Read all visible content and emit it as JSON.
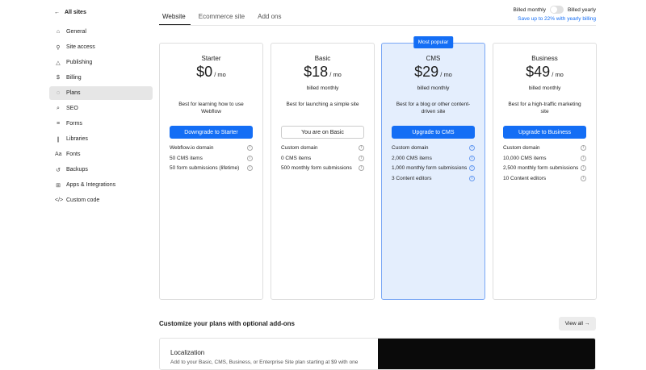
{
  "sidebar": {
    "back": "All sites",
    "items": [
      {
        "label": "General",
        "icon": "⌂"
      },
      {
        "label": "Site access",
        "icon": "⚲"
      },
      {
        "label": "Publishing",
        "icon": "△"
      },
      {
        "label": "Billing",
        "icon": "$"
      },
      {
        "label": "Plans",
        "icon": "◌"
      },
      {
        "label": "SEO",
        "icon": "⌕"
      },
      {
        "label": "Forms",
        "icon": "≡"
      },
      {
        "label": "Libraries",
        "icon": "∥"
      },
      {
        "label": "Fonts",
        "icon": "Aa"
      },
      {
        "label": "Backups",
        "icon": "↺"
      },
      {
        "label": "Apps & Integrations",
        "icon": "⊞"
      },
      {
        "label": "Custom code",
        "icon": "</>"
      }
    ]
  },
  "tabs": [
    "Website",
    "Ecommerce site",
    "Add ons"
  ],
  "billing": {
    "monthly": "Billed monthly",
    "yearly": "Billed yearly",
    "save": "Save up to 22% with yearly billing"
  },
  "plans": [
    {
      "name": "Starter",
      "price": "$0",
      "per": " / mo",
      "billed": "",
      "desc": "Best for learning how to use Webflow",
      "button": "Downgrade to Starter",
      "features": [
        "Webflow.io domain",
        "50 CMS items",
        "50 form submissions (lifetime)"
      ]
    },
    {
      "name": "Basic",
      "price": "$18",
      "per": " / mo",
      "billed": "billed monthly",
      "desc": "Best for launching a simple site",
      "button": "You are on Basic",
      "features": [
        "Custom domain",
        "0 CMS items",
        "500 monthly form submissions"
      ]
    },
    {
      "name": "CMS",
      "price": "$29",
      "per": " / mo",
      "billed": "billed monthly",
      "desc": "Best for a blog or other content-driven site",
      "button": "Upgrade to CMS",
      "badge": "Most popular",
      "features": [
        "Custom domain",
        "2,000 CMS items",
        "1,000 monthly form submissions",
        "3 Content editors"
      ]
    },
    {
      "name": "Business",
      "price": "$49",
      "per": " / mo",
      "billed": "billed monthly",
      "desc": "Best for a high-traffic marketing site",
      "button": "Upgrade to Business",
      "features": [
        "Custom domain",
        "10,000 CMS items",
        "2,500 monthly form submissions",
        "10 Content editors"
      ]
    }
  ],
  "addons": {
    "heading": "Customize your plans with optional add-ons",
    "view_all": "View all →",
    "localization_title": "Localization",
    "localization_desc": "Add to your Basic, CMS, Business, or Enterprise Site plan starting at $9 with one"
  }
}
